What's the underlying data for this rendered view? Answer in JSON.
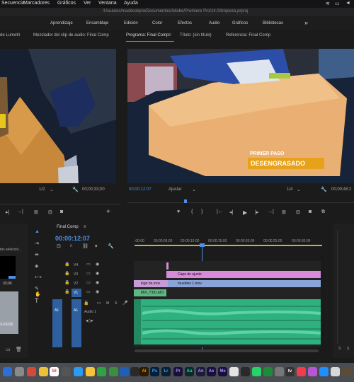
{
  "menubar": {
    "items": [
      "Secuencia",
      "Marcadores",
      "Gráficos",
      "Ver",
      "Ventana",
      "Ayuda"
    ]
  },
  "titlebar": {
    "path": "/Usuarios/macbookpro/Documentos/Adobe/Premiere Pro/14.0/limpieza.prproj"
  },
  "workspace": {
    "tabs": [
      "Aprendizaje",
      "Ensamblaje",
      "Edición",
      "Color",
      "Efectos",
      "Audio",
      "Gráficos",
      "Bibliotecas"
    ],
    "more": "»"
  },
  "source_panel": {
    "tab_lumetri": "de Lumetri",
    "tab_audio_mixer": "Mezclador del clip de audio: Final Comp",
    "ratio": "1/2",
    "timecode": "00;00;33;00"
  },
  "program_panel": {
    "tab_program": "Programa: Final Comp",
    "tab_menu": "≡",
    "tab_title": "Título: (sin título)",
    "tab_reference": "Referencia: Final Comp",
    "overlay_line1": "PRIMER PASO",
    "overlay_line2": "DESENGRASADO",
    "timecode_current": "00;00:12:07",
    "fit": "Ajustar",
    "ratio": "1/4",
    "timecode_end": "00;00;48:2"
  },
  "project_panel": {
    "label_selected": "tos selecció...",
    "value_time": "33;00",
    "value_code": "3-23220"
  },
  "timeline": {
    "tab": "Final Comp",
    "tab_menu": "≡",
    "timecode": "00:00:12:07",
    "ruler": [
      ":00:00",
      "00:00:05:00",
      "00:00:10:00",
      "00:00:15:00",
      "00:00:20:00",
      "00:00:25:00",
      "00:00:30:00"
    ],
    "tracks": [
      {
        "name": "V4"
      },
      {
        "name": "V3"
      },
      {
        "name": "V2"
      },
      {
        "name": "V1"
      },
      {
        "name": "A1"
      }
    ],
    "audio_track_label": "Audio 1",
    "audio_track_src": "A1",
    "clips": {
      "capa": "Capa de ajuste",
      "logo": "logo bn.mov",
      "muebles": "muebles 1.mov",
      "mvi": "MVI_7391.MO"
    }
  },
  "dock": {
    "items": [
      "Ai",
      "Ps",
      "Lr",
      "Pr",
      "Au",
      "An",
      "Ae",
      "Me"
    ],
    "calendar_day": "16",
    "tv": "tv"
  },
  "colors": {
    "accent_blue": "#4f8fe6",
    "clip_pink": "#d78bd8",
    "clip_blue": "#8aa3d9",
    "clip_green": "#5fb884",
    "overlay_orange": "#e8a21a"
  }
}
